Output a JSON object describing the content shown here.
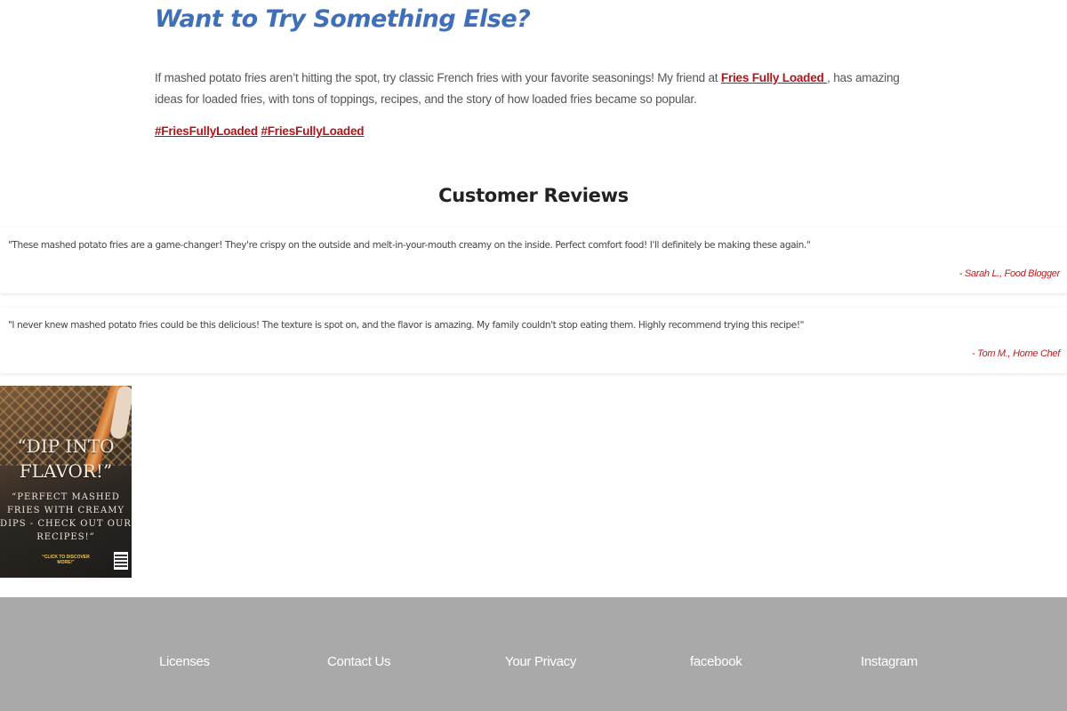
{
  "section": {
    "heading": "Want to Try Something Else?",
    "intro_before": "If mashed potato fries aren’t hitting the spot, try classic French fries with your favorite seasonings! My friend at ",
    "intro_link": "Fries Fully Loaded ",
    "intro_after": ", has amazing ideas for loaded fries, with tons of toppings, recipes, and the story of how loaded fries became so popular.",
    "tags": [
      "#FriesFullyLoaded",
      "#FriesFullyLoaded"
    ]
  },
  "reviews": {
    "title": "Customer Reviews",
    "items": [
      {
        "text": "\"These mashed potato fries are a game-changer! They're crispy on the outside and melt-in-your-mouth creamy on the inside. Perfect comfort food! I'll definitely be making these again.\"",
        "author": "- Sarah L., Food Blogger"
      },
      {
        "text": "\"I never knew mashed potato fries could be this delicious! The texture is spot on, and the flavor is amazing. My family couldn't stop eating them. Highly recommend trying this recipe!\"",
        "author": "- Tom M., Home Chef"
      }
    ]
  },
  "promo": {
    "headline": "“DIP INTO FLAVOR!”",
    "subtext": "“PERFECT MASHED FRIES WITH CREAMY DIPS - CHECK OUT OUR RECIPES!”",
    "cta": "“CLICK TO DISCOVER MORE!”"
  },
  "footer": {
    "links": [
      "Licenses",
      "Contact Us",
      "Your Privacy",
      "facebook",
      "Instagram"
    ]
  },
  "colors": {
    "heading": "#3f6fb8",
    "link": "#b0151b",
    "author": "#c2191f",
    "footer_bg": "#a9a9a9"
  }
}
